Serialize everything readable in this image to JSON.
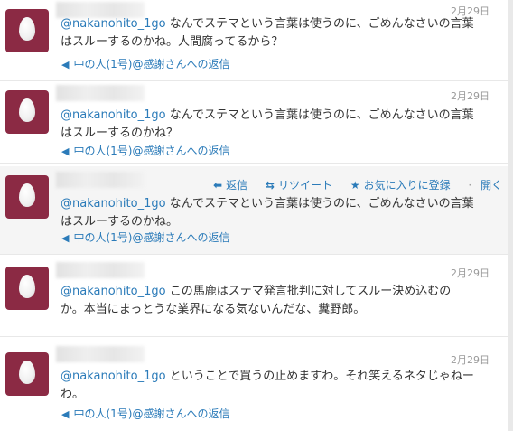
{
  "mention": "@nakanohito_1go",
  "reply_label": "中の人(1号)@感謝さんへの返信",
  "tweets": [
    {
      "date": "2月29日",
      "line1": "なんでステマという言葉は使うのに、ごめんなさいの言葉",
      "line2": "はスルーするのかね。人間腐ってるから？"
    },
    {
      "date": "2月29日",
      "line1": "なんでステマという言葉は使うのに、ごめんなさいの言葉",
      "line2": "はスルーするのかね？"
    },
    {
      "date": "",
      "line1": "なんでステマという言葉は使うのに、ごめんなさいの言葉",
      "line2": "はスルーするのかね。"
    },
    {
      "date": "2月29日",
      "line1": "この馬鹿はステマ発言批判に対してスルー決め込むの",
      "line2": "か。本当にまっとうな業界になる気ないんだな、糞野郎。"
    },
    {
      "date": "2月29日",
      "line1": "ということで買うの止めますわ。それ笑えるネタじゃねー",
      "line2": "わ。"
    }
  ],
  "actions": {
    "reply": "返信",
    "retweet": "リツイート",
    "favorite": "お気に入りに登録",
    "open": "開く"
  }
}
